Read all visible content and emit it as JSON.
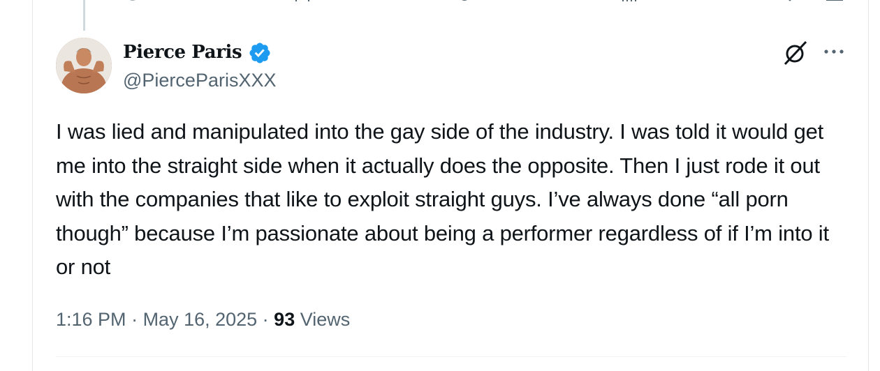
{
  "tweet": {
    "author": {
      "display_name": "Pierce Paris",
      "handle": "@PierceParisXXX",
      "verified": true,
      "verified_color": "#1d9bf0"
    },
    "text": "I was lied and manipulated into the gay side of the industry. I was told it would get me into the straight side when it actually does the opposite. Then I just rode it out with the companies that like to exploit straight guys. I’ve always done “all porn though” because I’m passionate about being a performer regardless of if I’m into it or not",
    "time": "1:16 PM",
    "separator": " · ",
    "date": "May 16, 2025",
    "views_count": "93",
    "views_label": " Views"
  },
  "icons": {
    "grok": "grok-icon",
    "more": "more-icon",
    "verified": "verified-badge-icon"
  },
  "colors": {
    "text": "#0f1419",
    "secondary": "#536471",
    "border": "#eff3f4"
  }
}
